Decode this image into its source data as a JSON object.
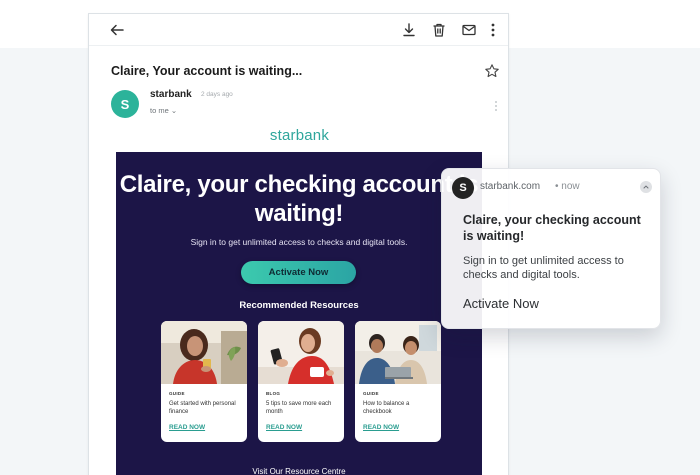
{
  "email": {
    "subject": "Claire, Your account is waiting...",
    "sender": "starbank",
    "sender_initial": "S",
    "time": "2 days ago",
    "recipient": "to me ⌄",
    "brand": "starbank"
  },
  "hero": {
    "title": "Claire, your checking account is waiting!",
    "subtitle": "Sign in to get unlimited access to checks and digital tools.",
    "button": "Activate Now",
    "resources_title": "Recommended Resources",
    "cards": [
      {
        "kicker": "GUIDE",
        "text": "Get started with personal finance",
        "link": "READ NOW"
      },
      {
        "kicker": "BLOG",
        "text": "5 tips to save more each month",
        "link": "READ NOW"
      },
      {
        "kicker": "GUIDE",
        "text": "How to balance a checkbook",
        "link": "READ NOW"
      }
    ],
    "visit_link": "Visit Our Resource Centre"
  },
  "notification": {
    "initial": "S",
    "source": "starbank.com",
    "when": "• now",
    "title": "Claire, your checking account is waiting!",
    "body": "Sign in to get unlimited access to checks and digital tools.",
    "action": "Activate Now"
  },
  "colors": {
    "accent": "#2fa69c",
    "hero_bg": "#1c1547",
    "avatar": "#2cb39a"
  },
  "icons": [
    "back-arrow-icon",
    "download-icon",
    "trash-icon",
    "mail-icon",
    "more-vert-icon",
    "star-icon"
  ]
}
